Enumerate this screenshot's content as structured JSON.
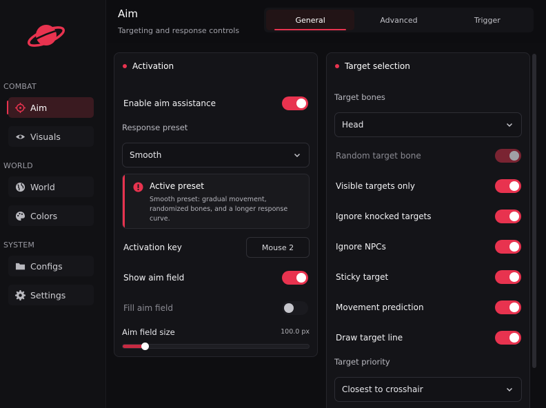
{
  "sidebar": {
    "sections": [
      {
        "label": "COMBAT",
        "items": [
          {
            "label": "Aim",
            "icon": "crosshair-icon",
            "active": true
          },
          {
            "label": "Visuals",
            "icon": "eye-icon"
          }
        ]
      },
      {
        "label": "WORLD",
        "items": [
          {
            "label": "World",
            "icon": "globe-icon"
          },
          {
            "label": "Colors",
            "icon": "palette-icon"
          }
        ]
      },
      {
        "label": "SYSTEM",
        "items": [
          {
            "label": "Configs",
            "icon": "folder-icon"
          },
          {
            "label": "Settings",
            "icon": "gear-icon"
          }
        ]
      }
    ]
  },
  "header": {
    "title": "Aim",
    "subtitle": "Targeting and response controls",
    "tabs": [
      {
        "label": "General",
        "active": true
      },
      {
        "label": "Advanced"
      },
      {
        "label": "Trigger"
      }
    ]
  },
  "activation": {
    "title": "Activation",
    "enable_label": "Enable aim assistance",
    "preset_label": "Response preset",
    "preset_value": "Smooth",
    "info_title": "Active preset",
    "info_body": "Smooth preset: gradual movement, randomized bones, and a longer response curve.",
    "key_label": "Activation key",
    "key_value": "Mouse 2",
    "show_field_label": "Show aim field",
    "fill_field_label": "Fill aim field",
    "field_size_label": "Aim field size",
    "field_size_value": "100.0 px",
    "field_size_fraction": 0.12
  },
  "target": {
    "title": "Target selection",
    "bones_label": "Target bones",
    "bones_value": "Head",
    "random_bone_label": "Random target bone",
    "visible_only_label": "Visible targets only",
    "ignore_knocked_label": "Ignore knocked targets",
    "ignore_npcs_label": "Ignore NPCs",
    "sticky_label": "Sticky target",
    "prediction_label": "Movement prediction",
    "draw_line_label": "Draw target line",
    "priority_label": "Target priority",
    "priority_value": "Closest to crosshair"
  },
  "colors": {
    "accent": "#e8334f"
  }
}
